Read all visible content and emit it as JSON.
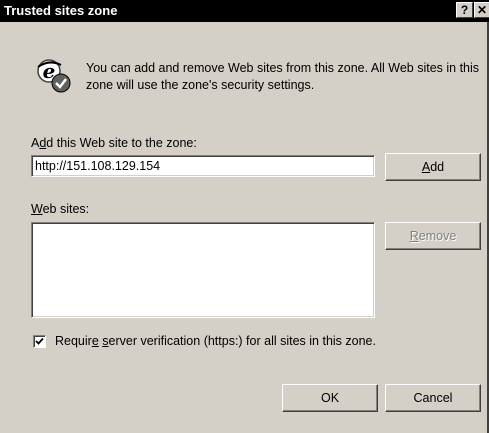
{
  "window": {
    "title": "Trusted sites zone",
    "help_label": "?",
    "close_label": "✕"
  },
  "info": {
    "icon": "ie-security-icon",
    "text": "You can add and remove Web sites from this zone. All Web sites in this zone will use the zone's security settings."
  },
  "add_site": {
    "label_prefix": "A",
    "label_accel": "d",
    "label_suffix": "d this Web site to the zone:",
    "value": "http://151.108.129.154",
    "button_accel": "A",
    "button_rest": "dd"
  },
  "web_sites": {
    "label_accel": "W",
    "label_rest": "eb sites:",
    "items": [],
    "remove_accel": "R",
    "remove_rest": "emove"
  },
  "verification": {
    "checked": true,
    "label_prefix": "Requir",
    "label_accel": "e",
    "label_mid": " ",
    "label_accel2": "s",
    "label_suffix": "erver verification (https:) for all sites in this zone."
  },
  "footer": {
    "ok_label": "OK",
    "cancel_label": "Cancel"
  },
  "colors": {
    "face": "#d4d0c8",
    "titlebar": "#000000"
  }
}
